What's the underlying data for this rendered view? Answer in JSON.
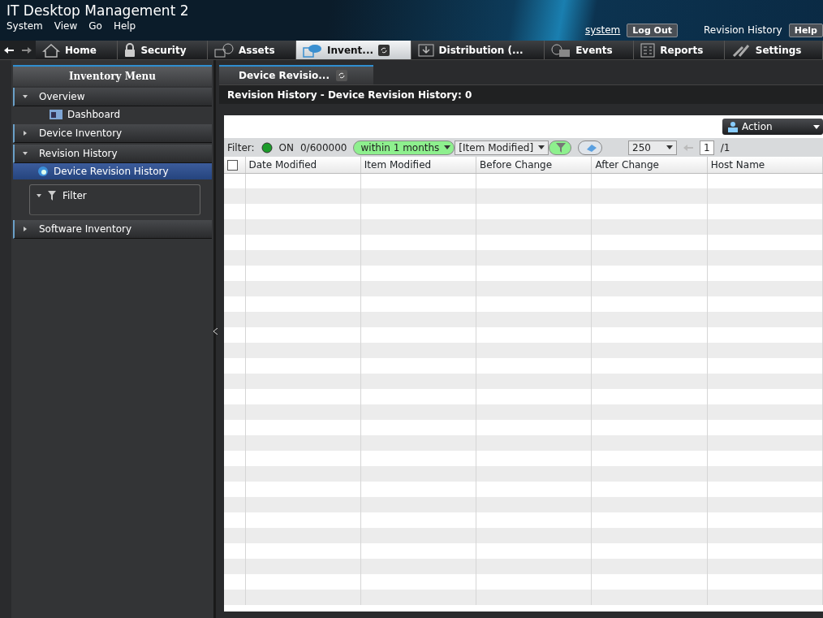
{
  "app_title": "IT Desktop Management 2",
  "menu": [
    "System",
    "View",
    "Go",
    "Help"
  ],
  "user": "system",
  "logout": "Log Out",
  "page_label": "Revision History",
  "help": "Help",
  "nav_tabs": [
    {
      "label": "Home",
      "selected": false
    },
    {
      "label": "Security",
      "selected": false
    },
    {
      "label": "Assets",
      "selected": false
    },
    {
      "label": "Invent...",
      "selected": true
    },
    {
      "label": "Distribution (...",
      "selected": false
    },
    {
      "label": "Events",
      "selected": false
    },
    {
      "label": "Reports",
      "selected": false
    },
    {
      "label": "Settings",
      "selected": false
    }
  ],
  "sidebar": {
    "title": "Inventory Menu",
    "items": [
      {
        "label": "Overview",
        "expanded": true,
        "children": [
          {
            "label": "Dashboard",
            "selected": false
          }
        ]
      },
      {
        "label": "Device Inventory",
        "expanded": false
      },
      {
        "label": "Revision History",
        "expanded": true,
        "children": [
          {
            "label": "Device Revision History",
            "selected": true
          }
        ]
      },
      {
        "kind": "filter",
        "label": "Filter",
        "expanded": true
      },
      {
        "label": "Software Inventory",
        "expanded": false
      }
    ]
  },
  "content_tab": "Device Revisio...",
  "heading": "Revision History - Device Revision History: 0",
  "action": "Action",
  "filter": {
    "label": "Filter:",
    "on": true,
    "status": "ON",
    "count": "0/600000",
    "period": "within 1 months",
    "item": "[Item Modified]",
    "page_size": "250",
    "page": "1",
    "pages": "/1"
  },
  "table": {
    "select_all_checked": false,
    "columns": [
      "Date Modified",
      "Item Modified",
      "Before Change",
      "After Change",
      "Host Name"
    ]
  }
}
